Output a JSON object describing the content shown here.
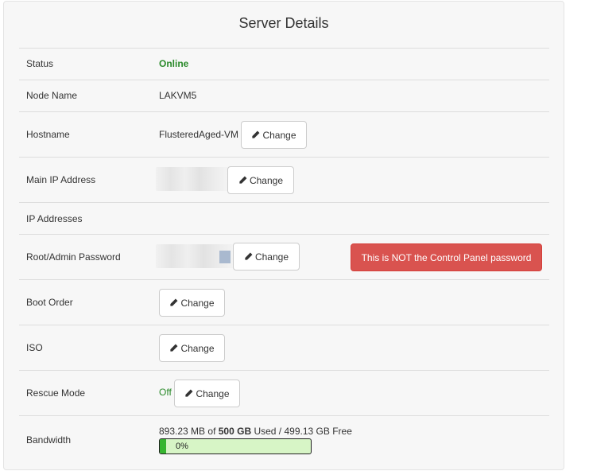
{
  "title": "Server Details",
  "change_label": "Change",
  "status": {
    "label": "Status",
    "value": "Online"
  },
  "node": {
    "label": "Node Name",
    "value": "LAKVM5"
  },
  "hostname": {
    "label": "Hostname",
    "value": "FlusteredAged-VM"
  },
  "main_ip": {
    "label": "Main IP Address"
  },
  "ip_addresses": {
    "label": "IP Addresses"
  },
  "root_password": {
    "label": "Root/Admin Password",
    "warning": "This is NOT the Control Panel password"
  },
  "boot_order": {
    "label": "Boot Order"
  },
  "iso": {
    "label": "ISO"
  },
  "rescue": {
    "label": "Rescue Mode",
    "value": "Off"
  },
  "bandwidth": {
    "label": "Bandwidth",
    "used": "893.23 MB",
    "of": "of",
    "total": "500 GB",
    "used_word": "Used /",
    "free": "499.13 GB Free",
    "percent_text": "0%",
    "percent": 0.0017
  },
  "colors": {
    "online": "#2a8a2a",
    "danger": "#d9534f",
    "progress": "#36b52f",
    "progress_track": "#d7f5c6"
  },
  "icons": {
    "change": "pencil-icon"
  }
}
